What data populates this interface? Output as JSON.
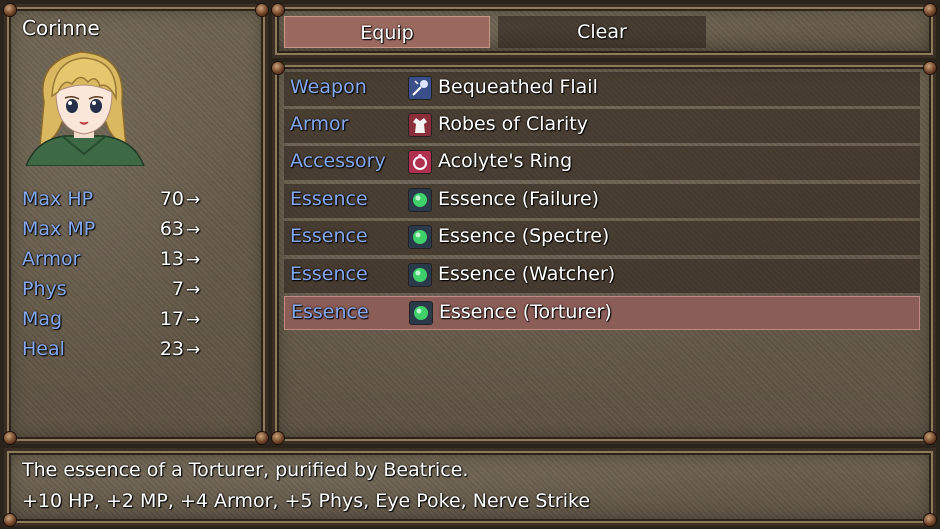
{
  "actor": {
    "name": "Corinne",
    "portrait_icon": "blonde-heroine-portrait"
  },
  "stats": [
    {
      "label": "Max HP",
      "value": "70",
      "arrow": "→"
    },
    {
      "label": "Max MP",
      "value": "63",
      "arrow": "→"
    },
    {
      "label": "Armor",
      "value": "13",
      "arrow": "→"
    },
    {
      "label": "Phys",
      "value": "7",
      "arrow": "→"
    },
    {
      "label": "Mag",
      "value": "17",
      "arrow": "→"
    },
    {
      "label": "Heal",
      "value": "23",
      "arrow": "→"
    }
  ],
  "commands": [
    {
      "label": "Equip",
      "selected": true
    },
    {
      "label": "Clear",
      "selected": false
    }
  ],
  "slots": [
    {
      "type": "Weapon",
      "item": "Bequeathed Flail",
      "icon": "flail-icon"
    },
    {
      "type": "Armor",
      "item": "Robes of Clarity",
      "icon": "robe-icon"
    },
    {
      "type": "Accessory",
      "item": "Acolyte's Ring",
      "icon": "ring-icon"
    },
    {
      "type": "Essence",
      "item": "Essence (Failure)",
      "icon": "green-orb-icon"
    },
    {
      "type": "Essence",
      "item": "Essence (Spectre)",
      "icon": "green-orb-icon"
    },
    {
      "type": "Essence",
      "item": "Essence (Watcher)",
      "icon": "green-orb-icon"
    },
    {
      "type": "Essence",
      "item": "Essence (Torturer)",
      "icon": "green-orb-icon",
      "selected": true
    }
  ],
  "help": {
    "line1": "The essence of a Torturer, purified by Beatrice.",
    "line2": "+10 HP, +2 MP, +4 Armor, +5 Phys, Eye Poke, Nerve Strike"
  },
  "colors": {
    "label_blue": "#84a8f0",
    "selection": "#8b5d57",
    "equip_command": "#9a6a60"
  }
}
